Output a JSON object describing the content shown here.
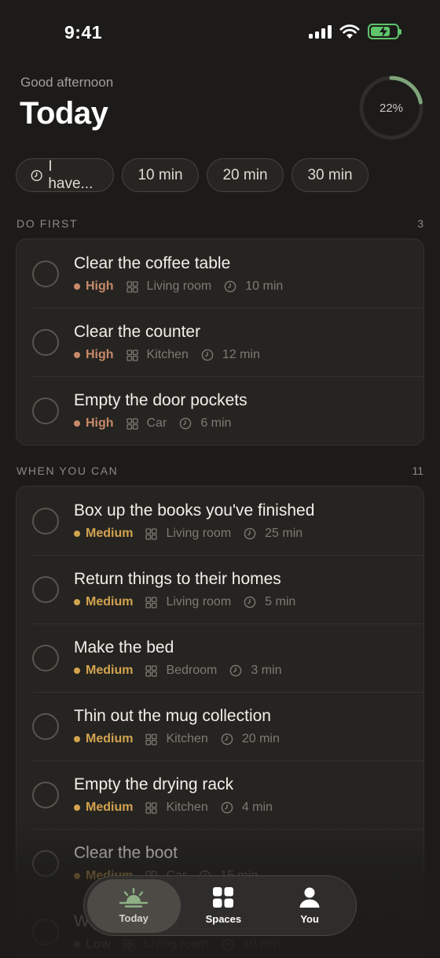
{
  "status_bar": {
    "time": "9:41"
  },
  "header": {
    "greeting": "Good afternoon",
    "title": "Today"
  },
  "progress": {
    "label": "22%",
    "value": 0.22,
    "color": "#7fa57a"
  },
  "time_filter": {
    "first_label": "I have...",
    "options": [
      "10 min",
      "20 min",
      "30 min"
    ]
  },
  "sections": [
    {
      "label": "DO FIRST",
      "count": "3",
      "tasks": [
        {
          "title": "Clear the coffee table",
          "priority": "High",
          "room": "Living room",
          "duration": "10 min"
        },
        {
          "title": "Clear the counter",
          "priority": "High",
          "room": "Kitchen",
          "duration": "12 min"
        },
        {
          "title": "Empty the door pockets",
          "priority": "High",
          "room": "Car",
          "duration": "6 min"
        }
      ]
    },
    {
      "label": "WHEN YOU CAN",
      "count": "11",
      "tasks": [
        {
          "title": "Box up the books you've finished",
          "priority": "Medium",
          "room": "Living room",
          "duration": "25 min"
        },
        {
          "title": "Return things to their homes",
          "priority": "Medium",
          "room": "Living room",
          "duration": "5 min"
        },
        {
          "title": "Make the bed",
          "priority": "Medium",
          "room": "Bedroom",
          "duration": "3 min"
        },
        {
          "title": "Thin out the mug collection",
          "priority": "Medium",
          "room": "Kitchen",
          "duration": "20 min"
        },
        {
          "title": "Empty the drying rack",
          "priority": "Medium",
          "room": "Kitchen",
          "duration": "4 min"
        },
        {
          "title": "Clear the boot",
          "priority": "Medium",
          "room": "Car",
          "duration": "15 min"
        },
        {
          "title": "Wipe the shelf",
          "priority": "Low",
          "room": "Living room",
          "duration": "10 min"
        }
      ]
    }
  ],
  "tab_bar": {
    "tabs": [
      {
        "label": "Today",
        "icon": "sunrise-icon"
      },
      {
        "label": "Spaces",
        "icon": "grid-icon"
      },
      {
        "label": "You",
        "icon": "person-icon"
      }
    ]
  },
  "colors": {
    "background": "#1c1b19",
    "high": "#c88a6a",
    "medium": "#d3a34f",
    "battery": "#5fc46a"
  }
}
